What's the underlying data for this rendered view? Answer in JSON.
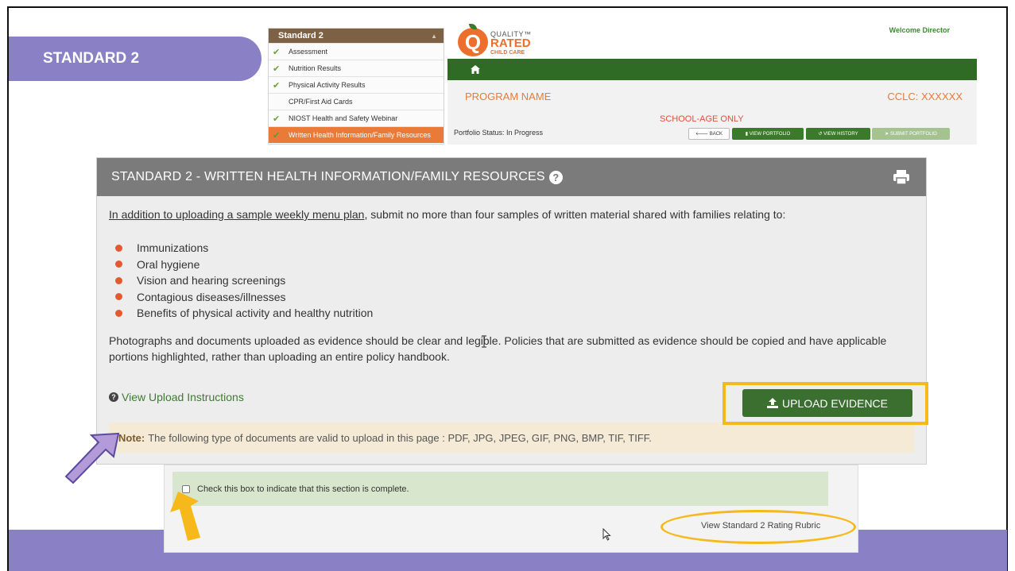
{
  "slide": {
    "banner_title": "STANDARD 2"
  },
  "sidebar": {
    "header": "Standard 2",
    "items": [
      {
        "label": "Assessment",
        "checked": true
      },
      {
        "label": "Nutrition Results",
        "checked": true
      },
      {
        "label": "Physical Activity Results",
        "checked": true
      },
      {
        "label": "CPR/First Aid Cards",
        "checked": false
      },
      {
        "label": "NIOST Health and Safety Webinar",
        "checked": true
      },
      {
        "label": "Written Health Information/Family Resources",
        "checked": true,
        "active": true
      }
    ]
  },
  "header": {
    "logo_line1": "QUALITY",
    "logo_line2": "RATED",
    "logo_line3": "CHILD CARE",
    "logo_tm": "™",
    "welcome": "Welcome Director",
    "program_name": "PROGRAM NAME",
    "cclc": "CCLC: XXXXXX",
    "school_age": "SCHOOL-AGE ONLY",
    "portfolio_status": "Portfolio Status: In Progress",
    "buttons": {
      "back": "BACK",
      "view_portfolio": "VIEW PORTFOLIO",
      "view_history": "VIEW HISTORY",
      "submit_portfolio": "SUBMIT PORTFOLIO"
    }
  },
  "panel": {
    "title": "STANDARD 2 - WRITTEN HEALTH INFORMATION/FAMILY RESOURCES",
    "intro_underlined": "In addition to uploading a sample weekly menu plan",
    "intro_rest": ", submit no more than four samples of written material shared with families relating to:",
    "bullets": [
      "Immunizations",
      "Oral hygiene",
      "Vision and hearing screenings",
      "Contagious diseases/illnesses",
      "Benefits of physical activity and healthy nutrition"
    ],
    "paragraph": "Photographs and documents uploaded as evidence should be clear and legible. Policies that are submitted as evidence should be copied and have applicable portions highlighted, rather than uploading an entire policy handbook.",
    "view_upload_instructions": "View Upload Instructions",
    "upload_button": "UPLOAD EVIDENCE",
    "note_label": "Note:",
    "note_text": "The following type of documents are valid to upload in this page : PDF, JPG, JPEG, GIF, PNG, BMP, TIF, TIFF."
  },
  "snippet": {
    "checkbox_label": "Check this box to indicate that this section is complete.",
    "rubric_link": "View Standard 2 Rating Rubric"
  },
  "colors": {
    "banner": "#8a80c6",
    "header_green": "#2f6b24",
    "button_green": "#3b6f30",
    "accent_orange": "#ea7a38",
    "highlight_gold": "#f6b81b"
  }
}
